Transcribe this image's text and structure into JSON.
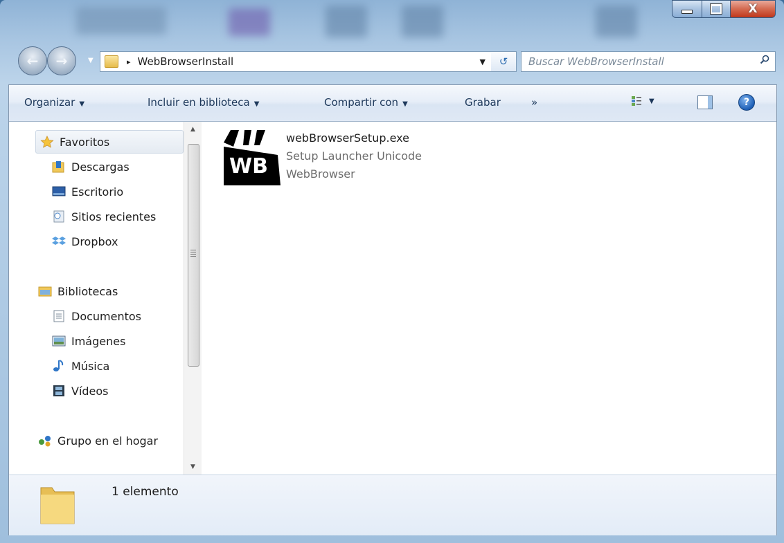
{
  "window": {
    "caption_minimize": "_",
    "caption_maximize": "",
    "caption_close": "X"
  },
  "nav": {
    "back_icon": "back-arrow-icon",
    "forward_icon": "forward-arrow-icon",
    "path_separator": "▸",
    "path": "WebBrowserInstall",
    "dropdown": "▼",
    "refresh": "↺",
    "search_placeholder": "Buscar WebBrowserInstall"
  },
  "toolbar": {
    "organize": "Organizar",
    "include_library": "Incluir en biblioteca",
    "share_with": "Compartir con",
    "burn": "Grabar",
    "more": "»",
    "dropdown_arrow": "▼",
    "help": "?"
  },
  "navpane": {
    "favorites": "Favoritos",
    "favorites_items": [
      "Descargas",
      "Escritorio",
      "Sitios recientes",
      "Dropbox"
    ],
    "libraries": "Bibliotecas",
    "library_items": [
      "Documentos",
      "Imágenes",
      "Música",
      "Vídeos"
    ],
    "homegroup": "Grupo en el hogar"
  },
  "file": {
    "name": "webBrowserSetup.exe",
    "description": "Setup Launcher Unicode",
    "company": "WebBrowser",
    "icon_text": "WB"
  },
  "details": {
    "count": "1 elemento"
  },
  "colors": {
    "accent": "#1e395b",
    "close": "#c0381c",
    "title_blue": "#a9c6e2"
  }
}
